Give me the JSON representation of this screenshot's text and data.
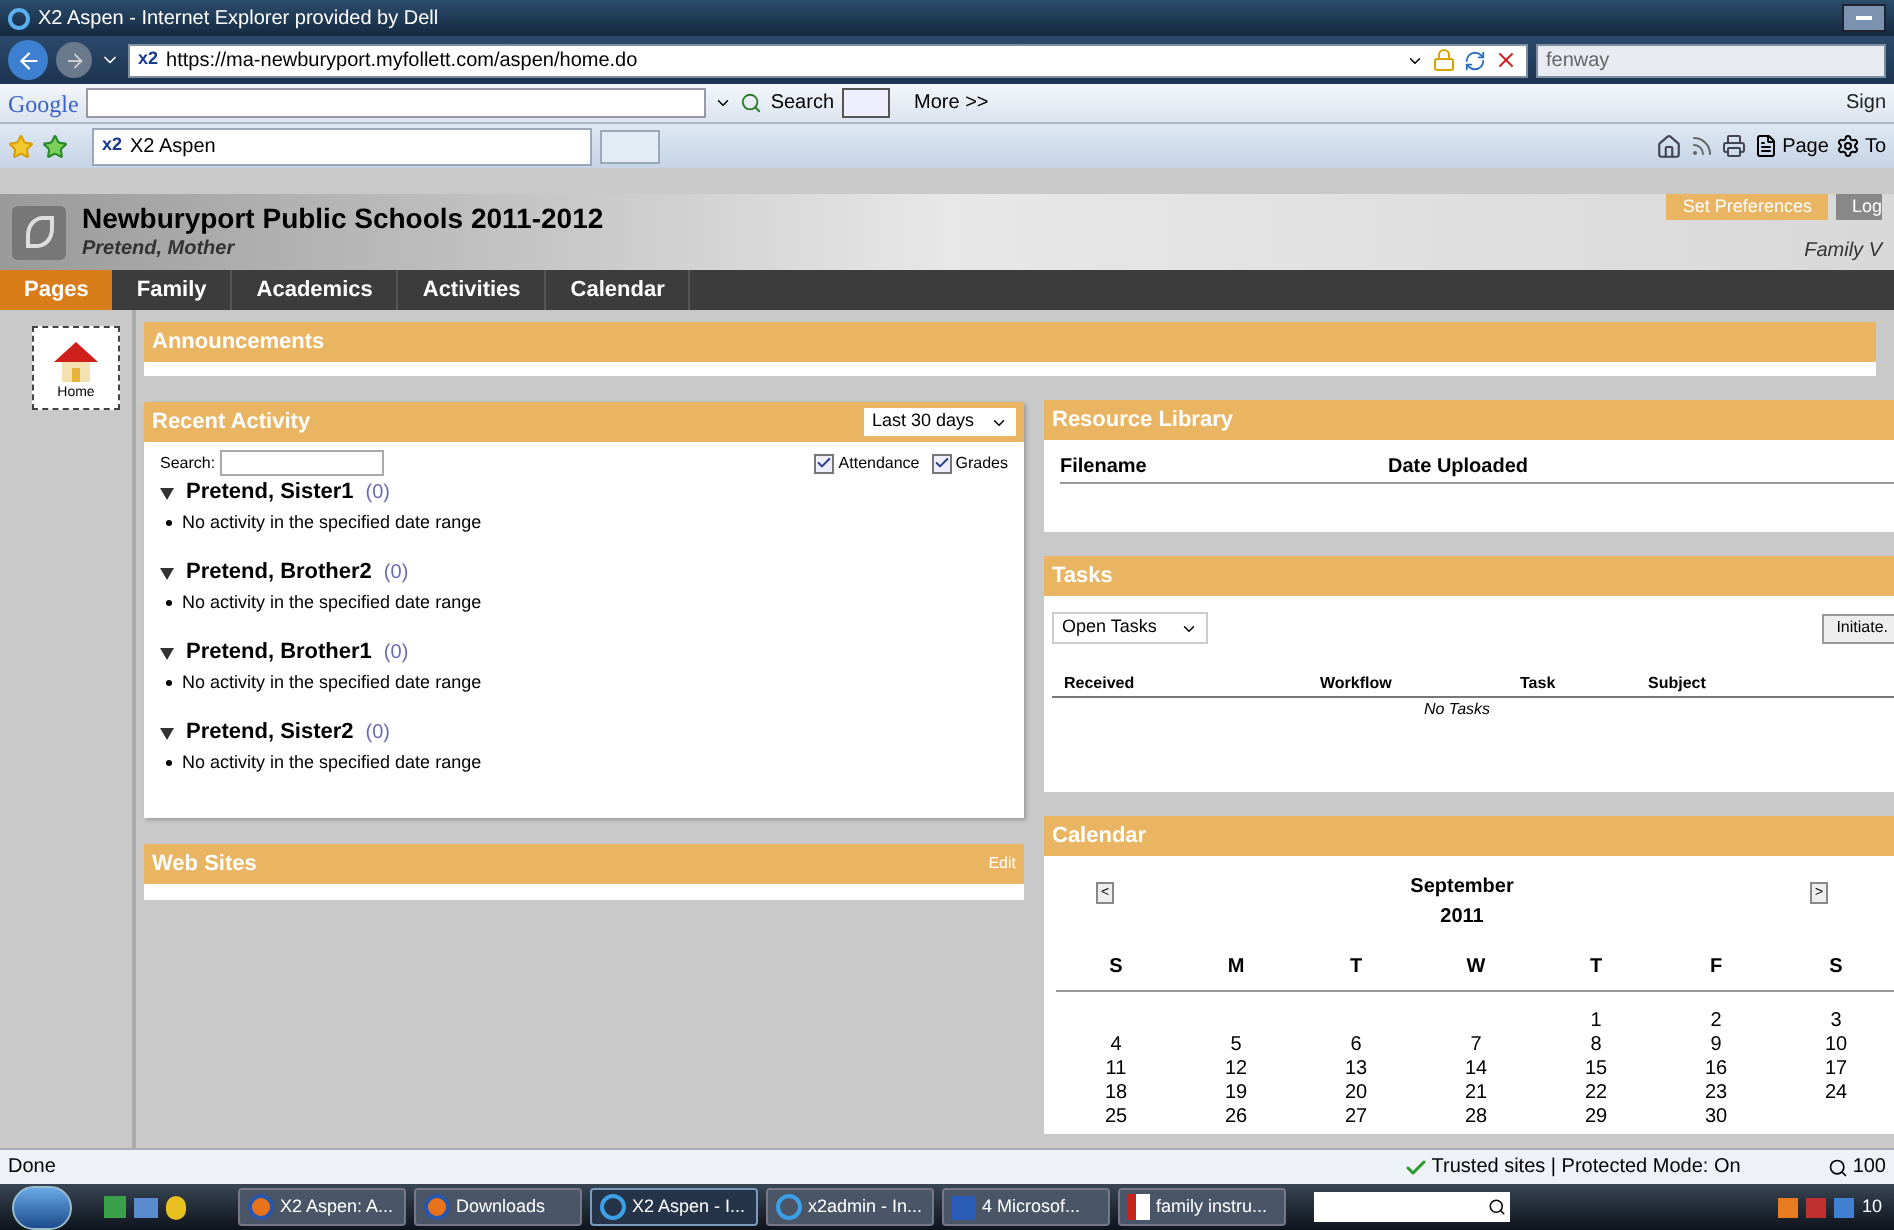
{
  "window": {
    "title": "X2 Aspen - Internet Explorer provided by Dell"
  },
  "address_bar": {
    "url_prefix": "x2",
    "url": "https://ma-newburyport.myfollett.com/aspen/home.do",
    "search_value": "fenway"
  },
  "google_bar": {
    "logo": "Google",
    "search_button": "Search",
    "more": "More >>",
    "sign_in": "Sign"
  },
  "browser_tab": {
    "icon_text": "x2",
    "title": "X2 Aspen"
  },
  "command_bar": {
    "page": "Page",
    "tools": "To"
  },
  "header": {
    "school": "Newburyport Public Schools 2011-2012",
    "user": "Pretend, Mother",
    "preferences": "Set Preferences",
    "logout": "Log",
    "view": "Family V"
  },
  "nav_tabs": [
    {
      "label": "Pages",
      "selected": true
    },
    {
      "label": "Family",
      "selected": false
    },
    {
      "label": "Academics",
      "selected": false
    },
    {
      "label": "Activities",
      "selected": false
    },
    {
      "label": "Calendar",
      "selected": false
    }
  ],
  "sidebar": {
    "items": [
      {
        "label": "Home",
        "selected": true
      }
    ]
  },
  "announcements": {
    "title": "Announcements"
  },
  "recent_activity": {
    "title": "Recent Activity",
    "range": "Last 30 days",
    "search_label": "Search:",
    "filters": [
      {
        "label": "Attendance",
        "checked": true
      },
      {
        "label": "Grades",
        "checked": true
      }
    ],
    "students": [
      {
        "name": "Pretend, Sister1",
        "count": "(0)",
        "expanded": true,
        "items": [
          "No activity in the specified date range"
        ]
      },
      {
        "name": "Pretend, Brother2",
        "count": "(0)",
        "expanded": true,
        "items": [
          "No activity in the specified date range"
        ]
      },
      {
        "name": "Pretend, Brother1",
        "count": "(0)",
        "expanded": true,
        "items": [
          "No activity in the specified date range"
        ]
      },
      {
        "name": "Pretend, Sister2",
        "count": "(0)",
        "expanded": true,
        "items": [
          "No activity in the specified date range"
        ]
      }
    ]
  },
  "web_sites": {
    "title": "Web Sites",
    "edit": "Edit"
  },
  "resource_library": {
    "title": "Resource Library",
    "columns": [
      "Filename",
      "Date Uploaded"
    ]
  },
  "tasks": {
    "title": "Tasks",
    "filter": "Open Tasks",
    "initiate": "Initiate.",
    "columns": [
      "Received",
      "Workflow",
      "Task",
      "Subject"
    ],
    "empty": "No Tasks"
  },
  "calendar": {
    "title": "Calendar",
    "prev": "<",
    "next": ">",
    "month": "September",
    "year": "2011",
    "weekdays": [
      "S",
      "M",
      "T",
      "W",
      "T",
      "F",
      "S"
    ],
    "weeks": [
      [
        "1",
        "2",
        "3"
      ],
      [
        "4",
        "5",
        "6",
        "7",
        "8",
        "9",
        "10"
      ],
      [
        "11",
        "12",
        "13",
        "14",
        "15",
        "16",
        "17"
      ],
      [
        "18",
        "19",
        "20",
        "21",
        "22",
        "23",
        "24"
      ],
      [
        "25",
        "26",
        "27",
        "28",
        "29",
        "30"
      ]
    ]
  },
  "status_bar": {
    "text": "Done",
    "zone": "Trusted sites | Protected Mode: On",
    "zoom": "100"
  },
  "taskbar": {
    "items": [
      {
        "label": "X2 Aspen: A...",
        "kind": "firefox",
        "selected": false
      },
      {
        "label": "Downloads",
        "kind": "firefox",
        "selected": false
      },
      {
        "label": "X2 Aspen - I...",
        "kind": "ie",
        "selected": true
      },
      {
        "label": "x2admin - In...",
        "kind": "ie",
        "selected": false
      },
      {
        "label": "4 Microsof...",
        "kind": "word",
        "selected": false
      },
      {
        "label": "family instru...",
        "kind": "pdf",
        "selected": false
      }
    ],
    "clock": "10"
  }
}
